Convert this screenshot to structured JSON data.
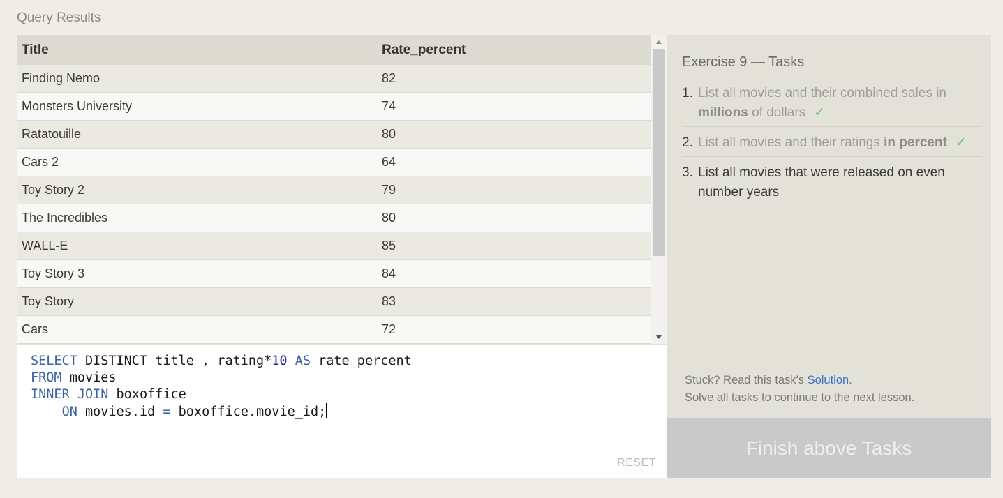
{
  "results_label": "Query Results",
  "table": {
    "columns": [
      "Title",
      "Rate_percent"
    ],
    "rows": [
      [
        "Finding Nemo",
        "82"
      ],
      [
        "Monsters University",
        "74"
      ],
      [
        "Ratatouille",
        "80"
      ],
      [
        "Cars 2",
        "64"
      ],
      [
        "Toy Story 2",
        "79"
      ],
      [
        "The Incredibles",
        "80"
      ],
      [
        "WALL-E",
        "85"
      ],
      [
        "Toy Story 3",
        "84"
      ],
      [
        "Toy Story",
        "83"
      ],
      [
        "Cars",
        "72"
      ]
    ]
  },
  "editor": {
    "lines": [
      [
        {
          "t": "SELECT",
          "k": "kw"
        },
        {
          "t": " DISTINCT title , rating*",
          "k": ""
        },
        {
          "t": "10",
          "k": "num"
        },
        {
          "t": " ",
          "k": ""
        },
        {
          "t": "AS",
          "k": "kw"
        },
        {
          "t": " rate_percent",
          "k": ""
        }
      ],
      [
        {
          "t": "FROM",
          "k": "kw"
        },
        {
          "t": " movies",
          "k": ""
        }
      ],
      [
        {
          "t": "INNER JOIN",
          "k": "kw"
        },
        {
          "t": " boxoffice",
          "k": ""
        }
      ],
      [
        {
          "t": "    ",
          "k": ""
        },
        {
          "t": "ON",
          "k": "kw"
        },
        {
          "t": " movies.id ",
          "k": ""
        },
        {
          "t": "=",
          "k": "kw"
        },
        {
          "t": " boxoffice.movie_id;",
          "k": ""
        }
      ]
    ],
    "reset_label": "RESET"
  },
  "tasks": {
    "title": "Exercise 9 — Tasks",
    "items": [
      {
        "num": "1.",
        "before": "List all movies and their combined sales in ",
        "bold": "millions",
        "after": " of dollars",
        "done": true,
        "check": "✓"
      },
      {
        "num": "2.",
        "before": "List all movies and their ratings ",
        "bold": "in percent",
        "after": "",
        "done": true,
        "check": "✓"
      },
      {
        "num": "3.",
        "before": "List all movies that were released on even number years",
        "bold": "",
        "after": "",
        "done": false,
        "check": ""
      }
    ],
    "stuck_prefix": "Stuck? Read this task's ",
    "solution_link": "Solution",
    "stuck_suffix": ".",
    "continue_text": "Solve all tasks to continue to the next lesson."
  },
  "finish_button": "Finish above Tasks",
  "colors": {
    "background": "#efede6",
    "keyword": "#3b62a3",
    "number": "#1d2a9a",
    "check": "#6fc36f",
    "link": "#3a6fc4",
    "finish_button_bg": "#c9c9c9"
  }
}
